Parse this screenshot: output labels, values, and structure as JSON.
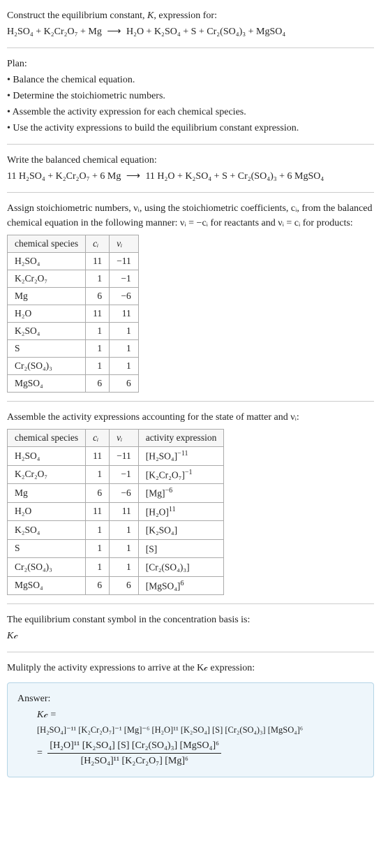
{
  "header": {
    "title_prefix": "Construct the equilibrium constant, ",
    "title_k": "K",
    "title_suffix": ", expression for:",
    "equation_lhs": "H₂SO₄ + K₂Cr₂O₇ + Mg",
    "arrow": "⟶",
    "equation_rhs": "H₂O + K₂SO₄ + S + Cr₂(SO₄)₃ + MgSO₄"
  },
  "plan": {
    "title": "Plan:",
    "items": [
      "• Balance the chemical equation.",
      "• Determine the stoichiometric numbers.",
      "• Assemble the activity expression for each chemical species.",
      "• Use the activity expressions to build the equilibrium constant expression."
    ]
  },
  "balanced": {
    "title": "Write the balanced chemical equation:",
    "lhs": "11 H₂SO₄ + K₂Cr₂O₇ + 6 Mg",
    "arrow": "⟶",
    "rhs": "11 H₂O + K₂SO₄ + S + Cr₂(SO₄)₃ + 6 MgSO₄"
  },
  "stoich": {
    "intro1": "Assign stoichiometric numbers, νᵢ, using the stoichiometric coefficients, cᵢ, from the balanced chemical equation in the following manner: νᵢ = −cᵢ for reactants and νᵢ = cᵢ for products:",
    "table": {
      "headers": [
        "chemical species",
        "cᵢ",
        "νᵢ"
      ],
      "rows": [
        {
          "sp": "H₂SO₄",
          "c": "11",
          "v": "−11"
        },
        {
          "sp": "K₂Cr₂O₇",
          "c": "1",
          "v": "−1"
        },
        {
          "sp": "Mg",
          "c": "6",
          "v": "−6"
        },
        {
          "sp": "H₂O",
          "c": "11",
          "v": "11"
        },
        {
          "sp": "K₂SO₄",
          "c": "1",
          "v": "1"
        },
        {
          "sp": "S",
          "c": "1",
          "v": "1"
        },
        {
          "sp": "Cr₂(SO₄)₃",
          "c": "1",
          "v": "1"
        },
        {
          "sp": "MgSO₄",
          "c": "6",
          "v": "6"
        }
      ]
    }
  },
  "activity": {
    "intro": "Assemble the activity expressions accounting for the state of matter and νᵢ:",
    "table": {
      "headers": [
        "chemical species",
        "cᵢ",
        "νᵢ",
        "activity expression"
      ],
      "rows": [
        {
          "sp": "H₂SO₄",
          "c": "11",
          "v": "−11",
          "a_base": "[H₂SO₄]",
          "a_sup": "−11"
        },
        {
          "sp": "K₂Cr₂O₇",
          "c": "1",
          "v": "−1",
          "a_base": "[K₂Cr₂O₇]",
          "a_sup": "−1"
        },
        {
          "sp": "Mg",
          "c": "6",
          "v": "−6",
          "a_base": "[Mg]",
          "a_sup": "−6"
        },
        {
          "sp": "H₂O",
          "c": "11",
          "v": "11",
          "a_base": "[H₂O]",
          "a_sup": "11"
        },
        {
          "sp": "K₂SO₄",
          "c": "1",
          "v": "1",
          "a_base": "[K₂SO₄]",
          "a_sup": ""
        },
        {
          "sp": "S",
          "c": "1",
          "v": "1",
          "a_base": "[S]",
          "a_sup": ""
        },
        {
          "sp": "Cr₂(SO₄)₃",
          "c": "1",
          "v": "1",
          "a_base": "[Cr₂(SO₄)₃]",
          "a_sup": ""
        },
        {
          "sp": "MgSO₄",
          "c": "6",
          "v": "6",
          "a_base": "[MgSO₄]",
          "a_sup": "6"
        }
      ]
    }
  },
  "symbol": {
    "line1": "The equilibrium constant symbol in the concentration basis is:",
    "kc": "K𝒸"
  },
  "multiply": {
    "line": "Mulitply the activity expressions to arrive at the K𝒸 expression:"
  },
  "answer": {
    "title": "Answer:",
    "kc_eq": "K𝒸 =",
    "product": "[H₂SO₄]⁻¹¹ [K₂Cr₂O₇]⁻¹ [Mg]⁻⁶ [H₂O]¹¹ [K₂SO₄] [S] [Cr₂(SO₄)₃] [MgSO₄]⁶",
    "frac_num": "[H₂O]¹¹ [K₂SO₄] [S] [Cr₂(SO₄)₃] [MgSO₄]⁶",
    "frac_den": "[H₂SO₄]¹¹ [K₂Cr₂O₇] [Mg]⁶",
    "equals": "="
  },
  "chart_data": {
    "type": "table",
    "tables": [
      {
        "title": "stoichiometric numbers",
        "headers": [
          "chemical species",
          "c_i",
          "ν_i"
        ],
        "rows": [
          [
            "H2SO4",
            11,
            -11
          ],
          [
            "K2Cr2O7",
            1,
            -1
          ],
          [
            "Mg",
            6,
            -6
          ],
          [
            "H2O",
            11,
            11
          ],
          [
            "K2SO4",
            1,
            1
          ],
          [
            "S",
            1,
            1
          ],
          [
            "Cr2(SO4)3",
            1,
            1
          ],
          [
            "MgSO4",
            6,
            6
          ]
        ]
      },
      {
        "title": "activity expressions",
        "headers": [
          "chemical species",
          "c_i",
          "ν_i",
          "activity expression"
        ],
        "rows": [
          [
            "H2SO4",
            11,
            -11,
            "[H2SO4]^-11"
          ],
          [
            "K2Cr2O7",
            1,
            -1,
            "[K2Cr2O7]^-1"
          ],
          [
            "Mg",
            6,
            -6,
            "[Mg]^-6"
          ],
          [
            "H2O",
            11,
            11,
            "[H2O]^11"
          ],
          [
            "K2SO4",
            1,
            1,
            "[K2SO4]"
          ],
          [
            "S",
            1,
            1,
            "[S]"
          ],
          [
            "Cr2(SO4)3",
            1,
            1,
            "[Cr2(SO4)3]"
          ],
          [
            "MgSO4",
            6,
            6,
            "[MgSO4]^6"
          ]
        ]
      }
    ]
  }
}
